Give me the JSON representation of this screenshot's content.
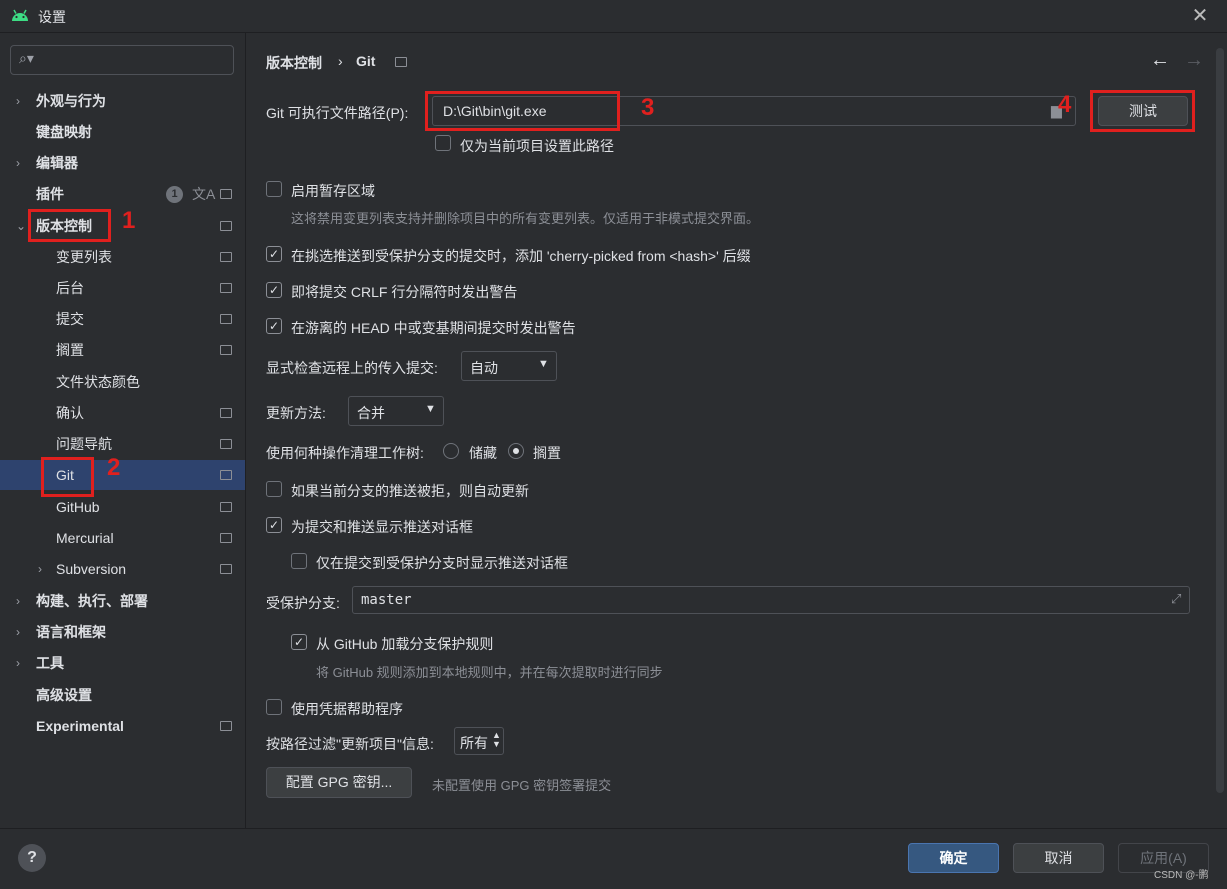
{
  "window": {
    "title": "设置",
    "close_glyph": "✕",
    "app_icon": "android-icon"
  },
  "search": {
    "placeholder": "",
    "value": ""
  },
  "sidebar": {
    "items": [
      {
        "label": "外观与行为",
        "chevron": "›"
      },
      {
        "label": "键盘映射"
      },
      {
        "label": "编辑器",
        "chevron": "›"
      },
      {
        "label": "插件",
        "badge": "1"
      },
      {
        "label": "版本控制",
        "chevron": "⌄"
      },
      {
        "label": "变更列表"
      },
      {
        "label": "后台"
      },
      {
        "label": "提交"
      },
      {
        "label": "搁置"
      },
      {
        "label": "文件状态颜色"
      },
      {
        "label": "确认"
      },
      {
        "label": "问题导航"
      },
      {
        "label": "Git"
      },
      {
        "label": "GitHub"
      },
      {
        "label": "Mercurial"
      },
      {
        "label": "Subversion",
        "chevron": "›"
      },
      {
        "label": "构建、执行、部署",
        "chevron": "›"
      },
      {
        "label": "语言和框架",
        "chevron": "›"
      },
      {
        "label": "工具",
        "chevron": "›"
      },
      {
        "label": "高级设置"
      },
      {
        "label": "Experimental"
      }
    ]
  },
  "annotations": [
    "1",
    "2",
    "3",
    "4"
  ],
  "breadcrumb": {
    "parent": "版本控制",
    "separator": "›",
    "current": "Git"
  },
  "nav": {
    "back": "←",
    "forward": "→"
  },
  "git": {
    "path_label": "Git 可执行文件路径(P):",
    "path_value": "D:\\Git\\bin\\git.exe",
    "test_button": "测试",
    "project_only": "仅为当前项目设置此路径",
    "staging_area": "启用暂存区域",
    "staging_hint": "这将禁用变更列表支持并删除项目中的所有变更列表。仅适用于非模式提交界面。",
    "cherry_pick": "在挑选推送到受保护分支的提交时，添加 'cherry-picked from <hash>' 后缀",
    "crlf_warn": "即将提交 CRLF 行分隔符时发出警告",
    "detached_warn": "在游离的 HEAD 中或变基期间提交时发出警告",
    "incoming_label": "显式检查远程上的传入提交:",
    "incoming_value": "自动",
    "update_label": "更新方法:",
    "update_value": "合并",
    "clean_label": "使用何种操作清理工作树:",
    "clean_opt1": "储藏",
    "clean_opt2": "搁置",
    "auto_update": "如果当前分支的推送被拒，则自动更新",
    "push_dialog": "为提交和推送显示推送对话框",
    "push_dialog_protected": "仅在提交到受保护分支时显示推送对话框",
    "protected_label": "受保护分支:",
    "protected_value": "master",
    "load_github": "从 GitHub 加载分支保护规则",
    "load_github_hint": "将 GitHub 规则添加到本地规则中，并在每次提取时进行同步",
    "credential_helper": "使用凭据帮助程序",
    "filter_label": "按路径过滤\"更新项目\"信息:",
    "filter_value": "所有",
    "gpg_button": "配置 GPG 密钥...",
    "gpg_hint": "未配置使用 GPG 密钥签署提交"
  },
  "footer": {
    "help": "?",
    "ok": "确定",
    "cancel": "取消",
    "apply": "应用(A)",
    "watermark": "CSDN @-鹏"
  },
  "colors": {
    "selection": "#2e436e",
    "primary_button": "#365880",
    "annotation": "#e0201e"
  }
}
